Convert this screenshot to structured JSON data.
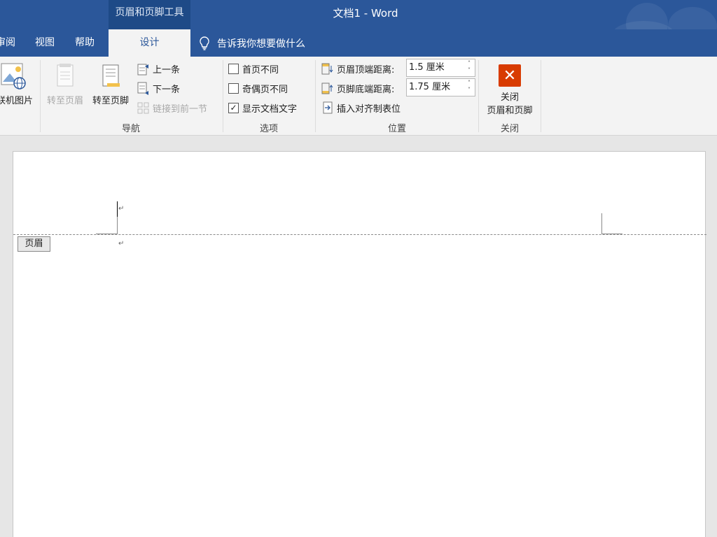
{
  "titlebar": {
    "context_tab": "页眉和页脚工具",
    "doc_title": "文档1  -  Word"
  },
  "tabs": [
    {
      "label": "审阅",
      "active": false
    },
    {
      "label": "视图",
      "active": false
    },
    {
      "label": "帮助",
      "active": false
    },
    {
      "label": "设计",
      "active": true
    }
  ],
  "tell_me": "告诉我你想要做什么",
  "ribbon": {
    "insert": {
      "online_pictures": "联机图片"
    },
    "navigation": {
      "label": "导航",
      "goto_header": "转至页眉",
      "goto_footer": "转至页脚",
      "previous": "上一条",
      "next": "下一条",
      "link_previous": "链接到前一节"
    },
    "options": {
      "label": "选项",
      "different_first_page": {
        "label": "首页不同",
        "checked": false
      },
      "different_odd_even": {
        "label": "奇偶页不同",
        "checked": false
      },
      "show_document_text": {
        "label": "显示文档文字",
        "checked": true
      }
    },
    "position": {
      "label": "位置",
      "header_from_top_label": "页眉顶端距离:",
      "header_from_top_value": "1.5 厘米",
      "footer_from_bottom_label": "页脚底端距离:",
      "footer_from_bottom_value": "1.75 厘米",
      "insert_alignment_tab": "插入对齐制表位"
    },
    "close": {
      "label": "关闭",
      "button_line1": "关闭",
      "button_line2": "页眉和页脚"
    }
  },
  "document": {
    "header_tag": "页眉",
    "paragraph_mark": "↵"
  },
  "colors": {
    "accent": "#2b579a",
    "context_tab": "#1e4a87",
    "close_button": "#d83b01",
    "ribbon_bg": "#f3f3f3"
  }
}
